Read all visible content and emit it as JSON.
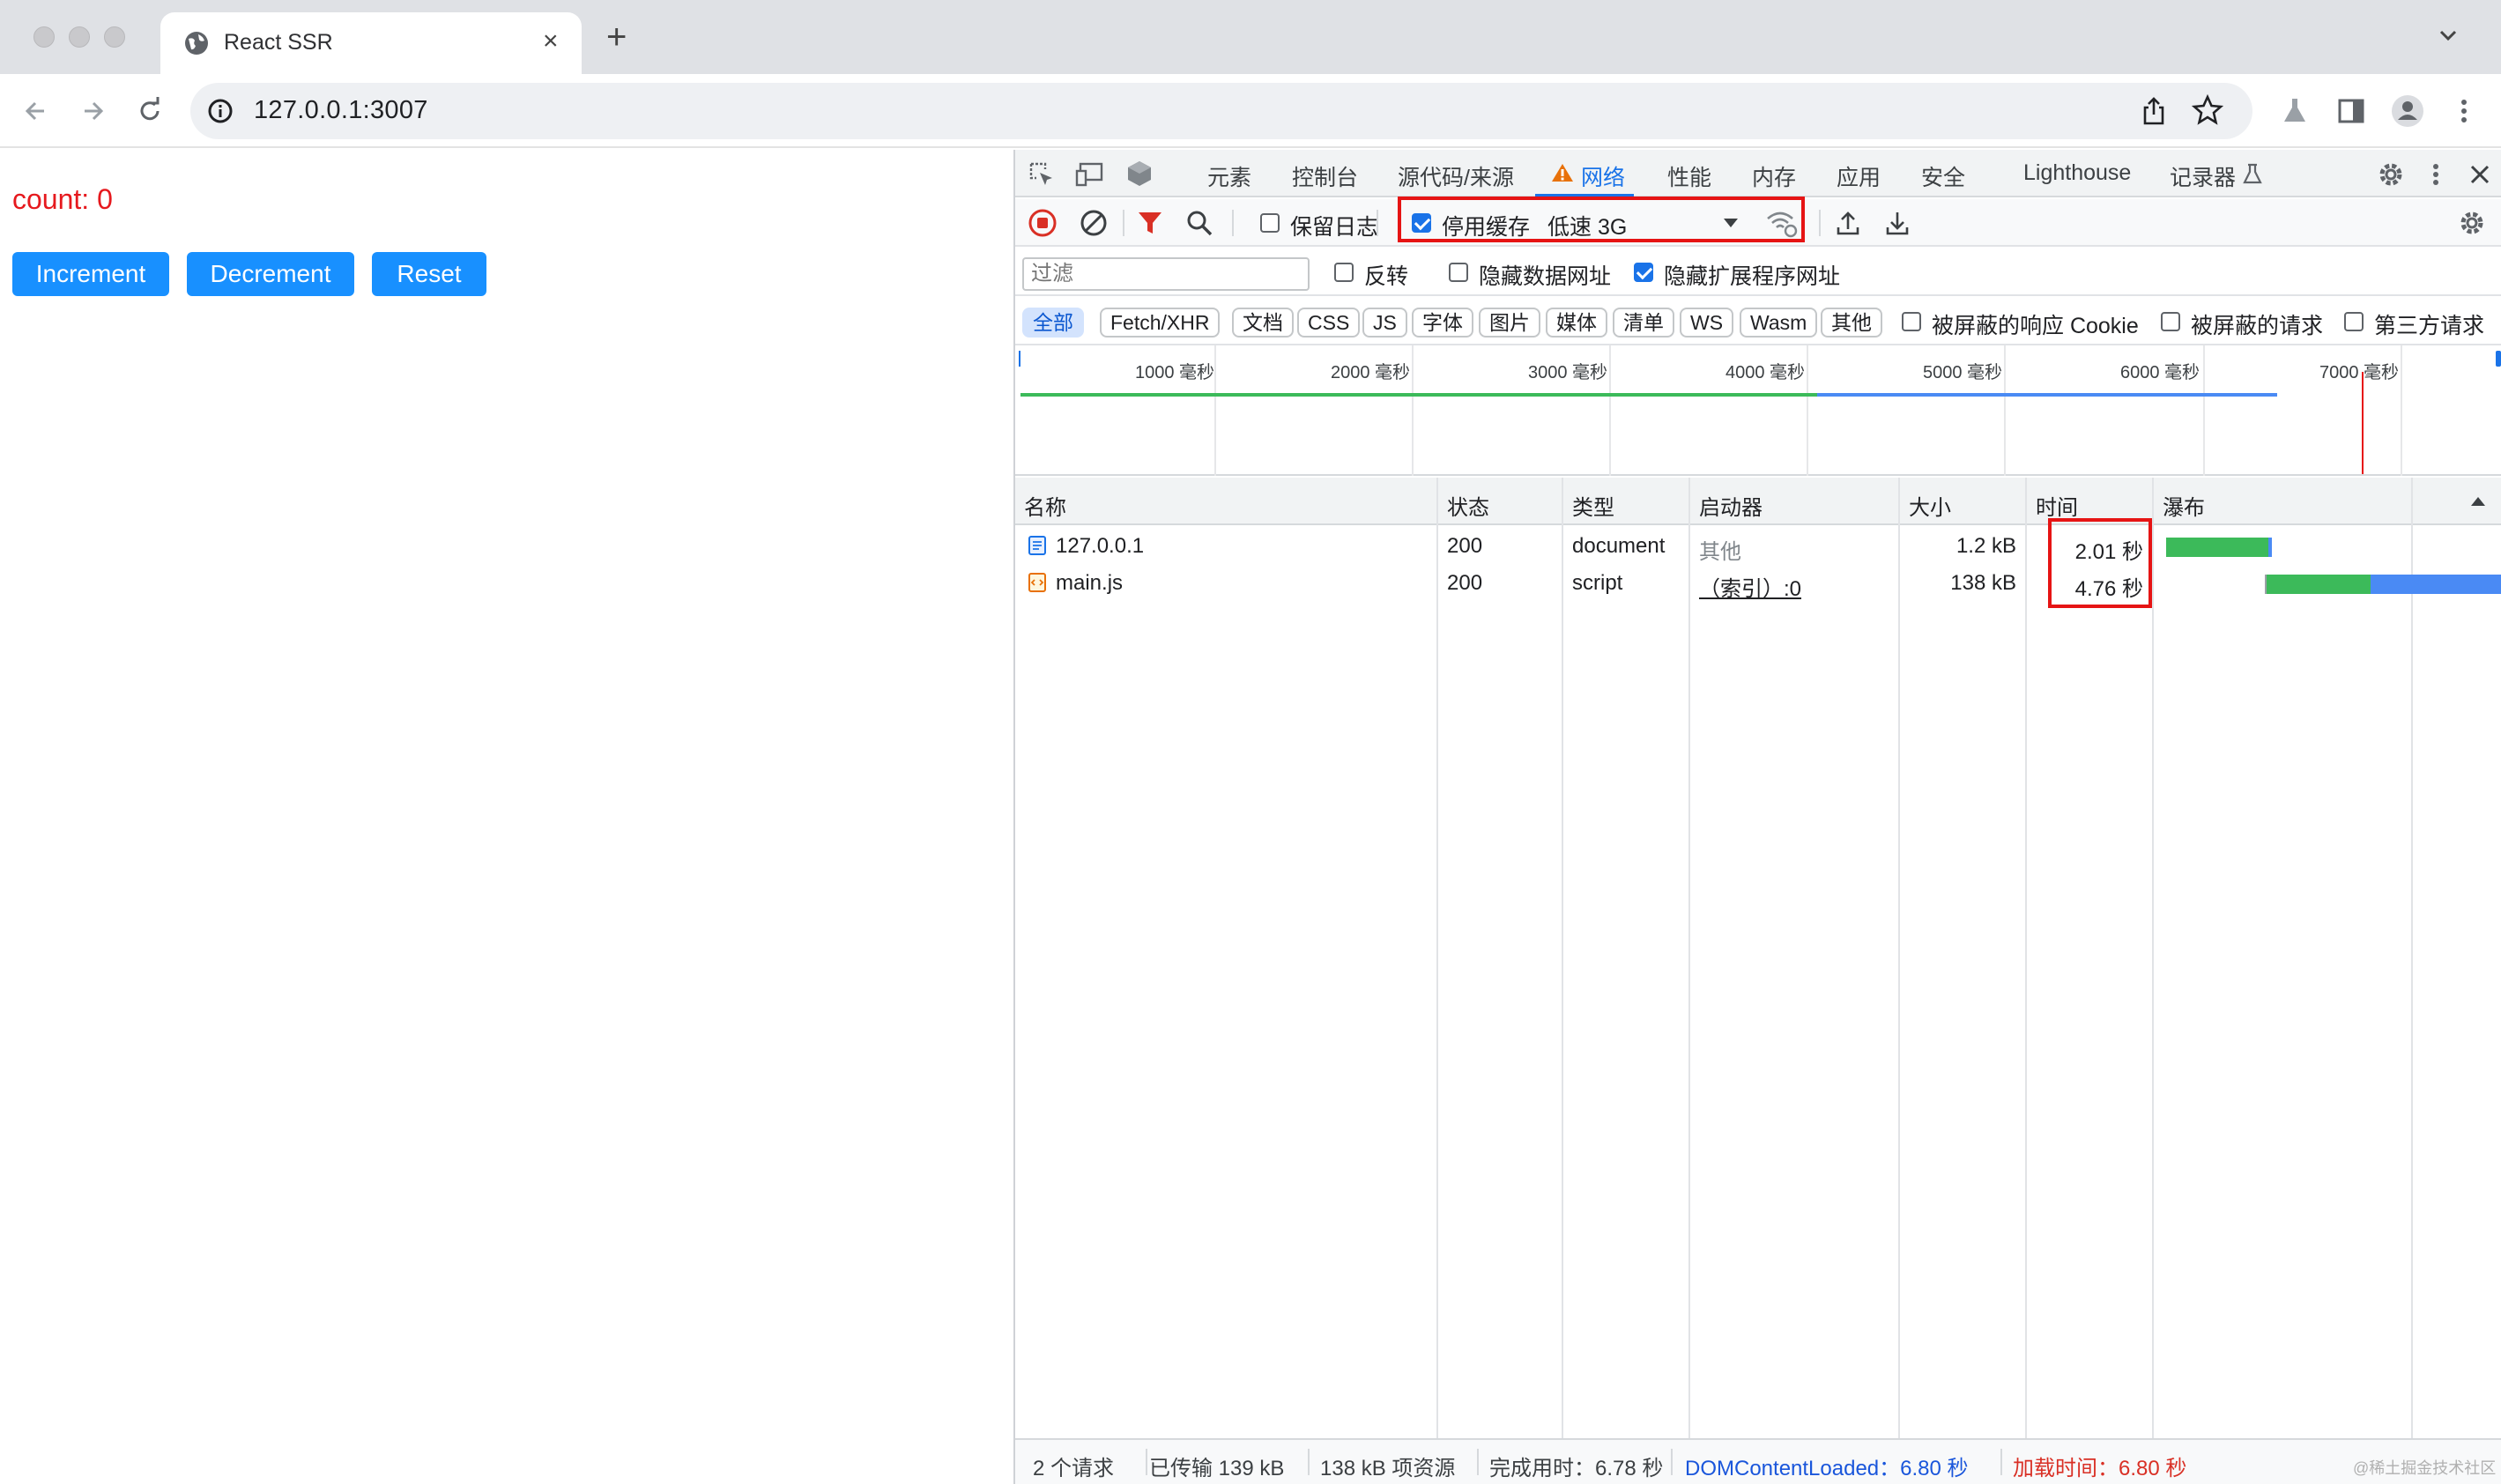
{
  "browser": {
    "tab_title": "React SSR",
    "url": "127.0.0.1:3007"
  },
  "page": {
    "count_text": "count: 0",
    "buttons": {
      "increment": "Increment",
      "decrement": "Decrement",
      "reset": "Reset"
    }
  },
  "devtools": {
    "tabs": [
      "元素",
      "控制台",
      "源代码/来源",
      "网络",
      "性能",
      "内存",
      "应用",
      "安全",
      "Lighthouse",
      "记录器"
    ],
    "toolbar": {
      "preserve_log": "保留日志",
      "disable_cache": "停用缓存",
      "throttling": "低速 3G"
    },
    "filter": {
      "placeholder": "过滤",
      "invert": "反转",
      "hide_data_urls": "隐藏数据网址",
      "hide_ext_urls": "隐藏扩展程序网址"
    },
    "types": [
      "全部",
      "Fetch/XHR",
      "文档",
      "CSS",
      "JS",
      "字体",
      "图片",
      "媒体",
      "清单",
      "WS",
      "Wasm",
      "其他"
    ],
    "type_options": {
      "blocked_cookies": "被屏蔽的响应 Cookie",
      "blocked_requests": "被屏蔽的请求",
      "third_party": "第三方请求"
    },
    "overview_ticks": [
      "1000 毫秒",
      "2000 毫秒",
      "3000 毫秒",
      "4000 毫秒",
      "5000 毫秒",
      "6000 毫秒",
      "7000 毫秒"
    ],
    "columns": {
      "name": "名称",
      "status": "状态",
      "type": "类型",
      "initiator": "启动器",
      "size": "大小",
      "time": "时间",
      "waterfall": "瀑布"
    },
    "rows": [
      {
        "name": "127.0.0.1",
        "status": "200",
        "type": "document",
        "initiator": "其他",
        "size": "1.2 kB",
        "time": "2.01 秒"
      },
      {
        "name": "main.js",
        "status": "200",
        "type": "script",
        "initiator": "（索引）:0",
        "size": "138 kB",
        "time": "4.76 秒"
      }
    ],
    "status_bar": {
      "requests": "2 个请求",
      "transferred": "已传输 139 kB",
      "resources": "138 kB 项资源",
      "finish": "完成用时：6.78 秒",
      "dcl": "DOMContentLoaded：6.80 秒",
      "load": "加载时间：6.80 秒"
    }
  },
  "watermark": "@稀土掘金技术社区",
  "colors": {
    "accent": "#1a73e8",
    "page_button": "#1890ff",
    "count_red": "#e6191e",
    "highlight_red": "#e61414",
    "bar_green": "#3cba5a",
    "bar_blue": "#4a8af4"
  }
}
